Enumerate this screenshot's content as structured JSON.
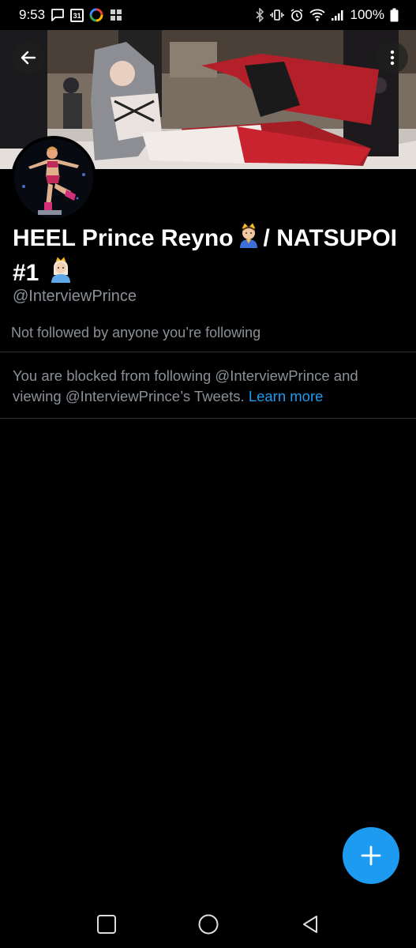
{
  "status_bar": {
    "time": "9:53",
    "calendar_day": "31",
    "battery": "100%",
    "icons": [
      "chat-icon",
      "calendar-icon",
      "circle-app-icon",
      "image-icon",
      "bluetooth-icon",
      "vibrate-icon",
      "alarm-icon",
      "wifi-icon",
      "signal-icon",
      "battery-icon"
    ]
  },
  "header": {
    "back_icon": "arrow-left-icon",
    "more_icon": "more-vertical-icon"
  },
  "profile": {
    "display_name_part1": "HEEL Prince Reyno",
    "display_name_part2": "/ NATSUPOI",
    "display_name_part3": "#1",
    "name_emojis": [
      "prince-emoji",
      "princess-emoji"
    ],
    "handle": "@InterviewPrince",
    "followed_by": "Not followed by anyone you’re following",
    "blocked_message": "You are blocked from following @InterviewPrince and viewing @InterviewPrince’s Tweets.",
    "learn_more": "Learn more"
  },
  "fab": {
    "icon": "plus-icon"
  },
  "nav": {
    "icons": [
      "recents-icon",
      "home-icon",
      "back-icon"
    ]
  },
  "colors": {
    "background": "#000000",
    "accent": "#1d9bf0",
    "secondary_text": "#8b9096",
    "divider": "#2f3336"
  }
}
